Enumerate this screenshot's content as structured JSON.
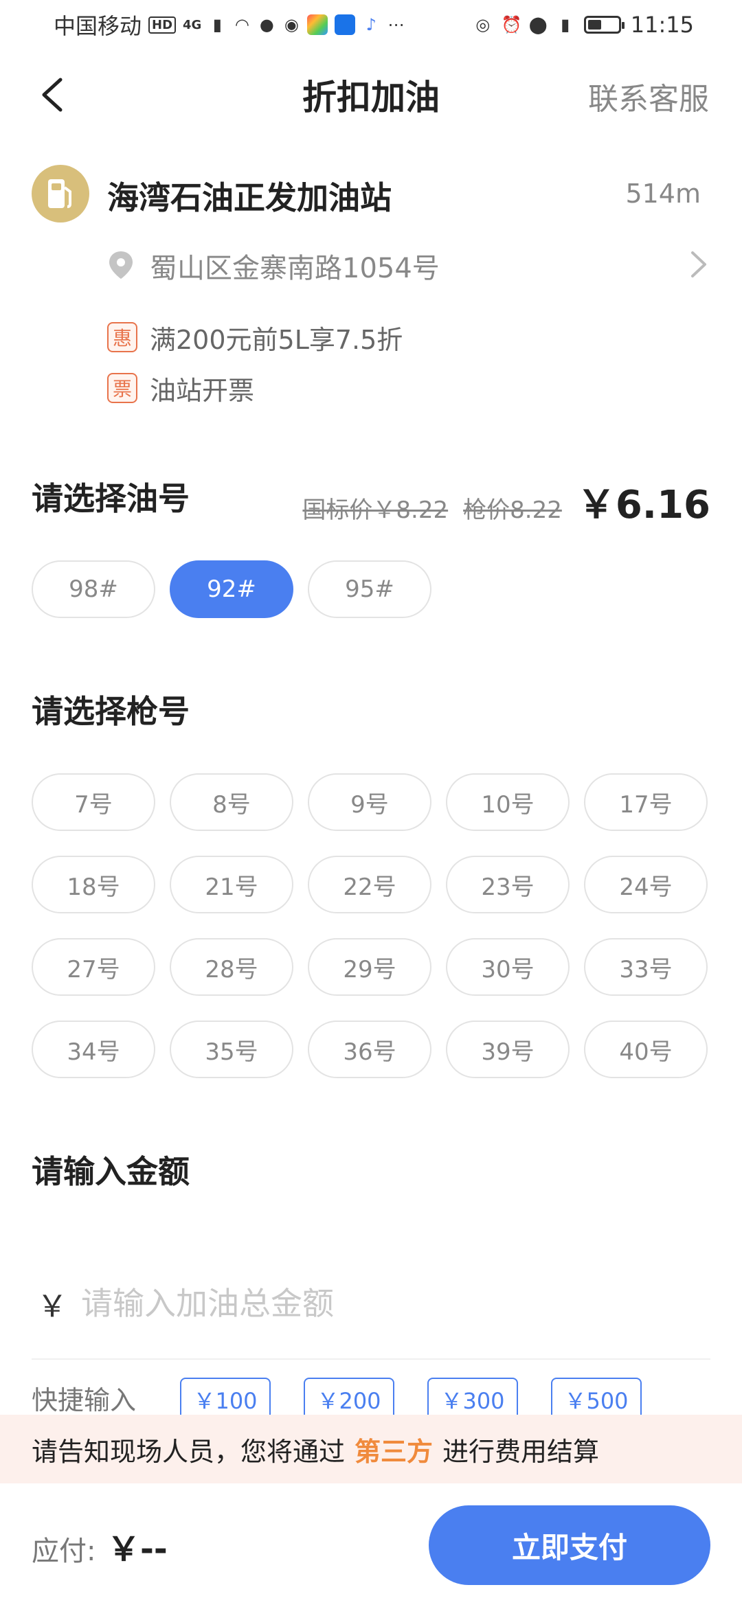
{
  "status_bar": {
    "carrier": "中国移动",
    "hd": "HD",
    "network": "4G",
    "time": "11:15",
    "battery_level": 0.45
  },
  "nav": {
    "title": "折扣加油",
    "contact": "联系客服"
  },
  "station": {
    "name": "海湾石油正发加油站",
    "distance": "514m",
    "address": "蜀山区金寨南路1054号",
    "tags": [
      {
        "badge": "惠",
        "text": "满200元前5L享7.5折"
      },
      {
        "badge": "票",
        "text": "油站开票"
      }
    ]
  },
  "fuel": {
    "title": "请选择油号",
    "national_price": "国标价￥8.22",
    "pump_price": "枪价8.22",
    "price": "￥6.16",
    "options": [
      "98#",
      "92#",
      "95#"
    ],
    "selected": "92#"
  },
  "guns": {
    "title": "请选择枪号",
    "items": [
      "7号",
      "8号",
      "9号",
      "10号",
      "17号",
      "18号",
      "21号",
      "22号",
      "23号",
      "24号",
      "27号",
      "28号",
      "29号",
      "30号",
      "33号",
      "34号",
      "35号",
      "36号",
      "39号",
      "40号"
    ]
  },
  "amount": {
    "title": "请输入金额",
    "currency": "￥",
    "placeholder": "请输入加油总金额",
    "quick_label": "快捷输入",
    "quick": [
      "￥100",
      "￥200",
      "￥300",
      "￥500"
    ]
  },
  "notice": {
    "before": "请告知现场人员，您将通过",
    "highlight": "第三方",
    "after": "进行费用结算"
  },
  "footer": {
    "due_label": "应付:",
    "due_value": "￥--",
    "pay_label": "立即支付"
  },
  "colors": {
    "accent": "#4a7ff0",
    "tag": "#e8734b",
    "highlight": "#f08a3c",
    "station_icon": "#d8bf7b"
  }
}
